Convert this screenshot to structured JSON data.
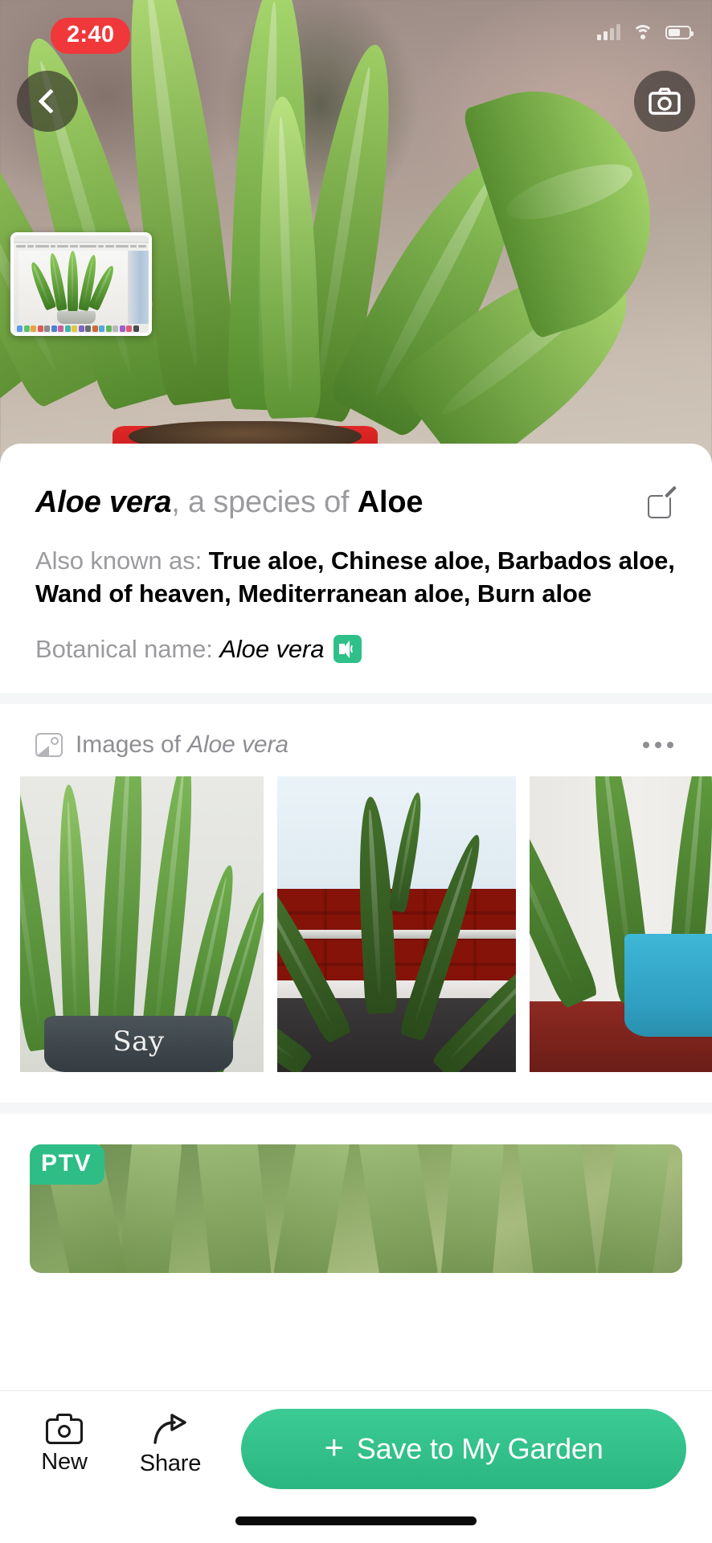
{
  "status_bar": {
    "recording_time": "2:40",
    "icons": [
      "signal-bars-icon",
      "wifi-icon",
      "battery-icon"
    ]
  },
  "hero": {
    "back_button_icon": "chevron-left-icon",
    "camera_button_icon": "camera-icon",
    "pip_thumbnail_label": "desktop-screenshot-thumbnail"
  },
  "info_card": {
    "species_name": "Aloe vera",
    "species_separator": ", a species of ",
    "genus_name": "Aloe",
    "edit_icon": "edit-square-icon",
    "also_known_as_label": "Also known as: ",
    "also_known_as_value": "True aloe, Chinese aloe, Barbados aloe, Wand of heaven, Mediterranean aloe, Burn aloe",
    "botanical_label": "Botanical name: ",
    "botanical_value": "Aloe vera",
    "speaker_icon": "speaker-volume-icon"
  },
  "images_section": {
    "icon": "image-placeholder-icon",
    "title_prefix": "Images of ",
    "title_italic": "Aloe vera",
    "overflow_icon": "more-horizontal-icon",
    "thumbnails": [
      {
        "alt": "aloe-plant-pale-wall",
        "pot_text": "Say"
      },
      {
        "alt": "aloe-plant-brick-wall",
        "pot_text": ""
      },
      {
        "alt": "aloe-plant-blue-pot",
        "pot_text": ""
      }
    ]
  },
  "ptv_section": {
    "badge": "PTV",
    "alt": "aloe-leaves-video-preview"
  },
  "bottom_bar": {
    "new_label": "New",
    "new_icon": "camera-icon",
    "share_label": "Share",
    "share_icon": "share-arrow-icon",
    "save_plus": "+",
    "save_label": "Save to My Garden"
  },
  "colors": {
    "accent_green": "#2FBD86",
    "save_button_green": "#33C28D",
    "recording_red": "#F0383A",
    "muted_text": "#8E8E93"
  }
}
